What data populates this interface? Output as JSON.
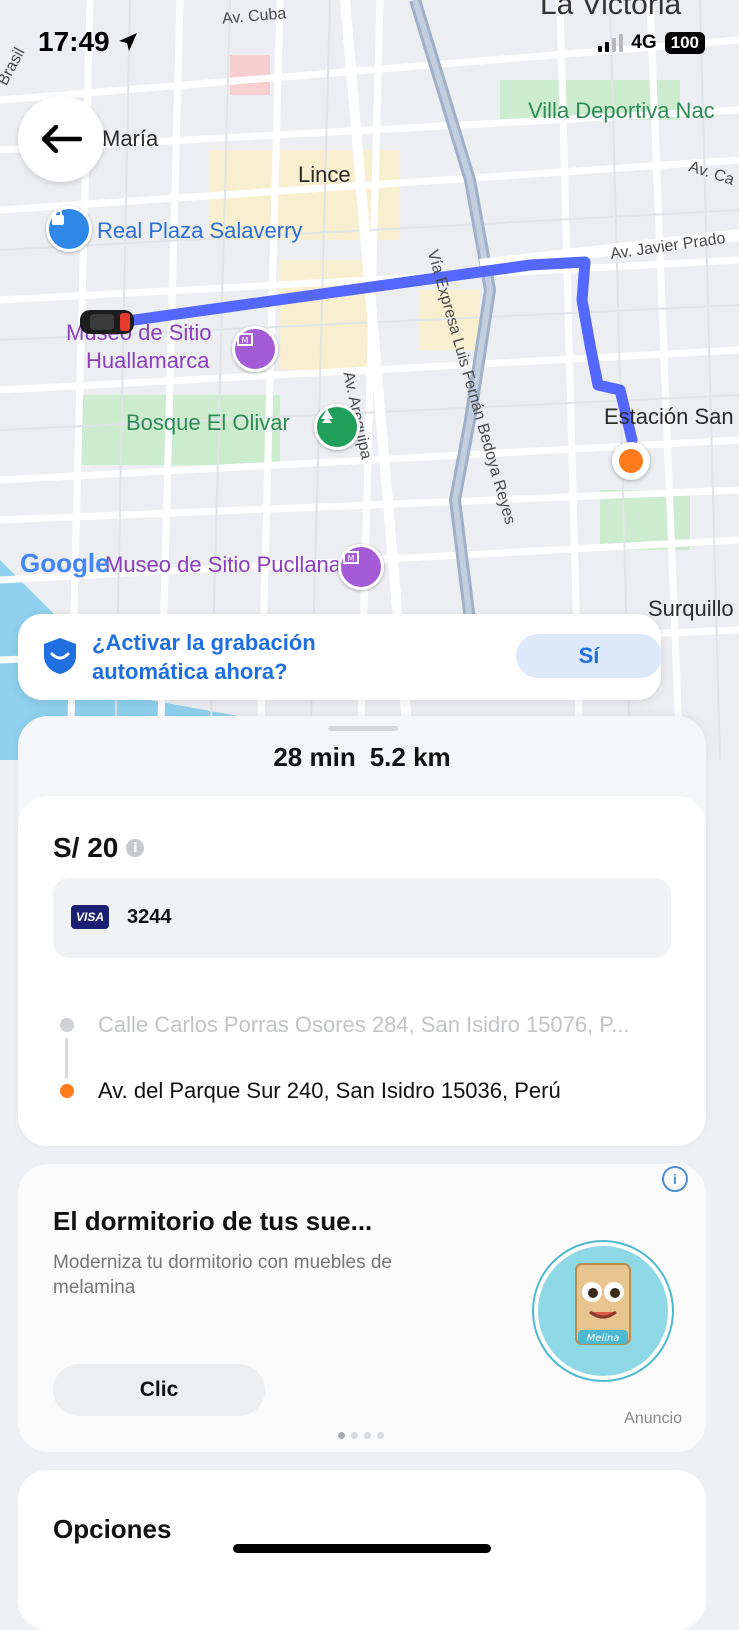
{
  "status_bar": {
    "time": "17:49",
    "network": "4G",
    "battery": "100"
  },
  "map": {
    "labels": {
      "top_right": "La Victoria",
      "av_cuba": "Av. Cuba",
      "brasil": "Brasil",
      "maria": "María",
      "lince": "Lince",
      "villa_deportiva": "Villa Deportiva Nac",
      "av_ca": "Av. Ca",
      "real_plaza": "Real Plaza Salaverry",
      "via_expresa": "Vía Expresa Luis Fernán Bedoya Reyes",
      "av_javier_prado": "Av. Javier Prado",
      "museo_hualla_1": "Museo de Sitio",
      "museo_hualla_2": "Huallamarca",
      "av_arequipa": "Av. Arequipa",
      "estacion": "Estación San",
      "bosque": "Bosque El Olivar",
      "museo_pucllana": "Museo de Sitio Pucllana",
      "surquillo": "Surquillo",
      "google": "Google"
    },
    "colors": {
      "route": "#5468ff",
      "destination": "#ff7a1a"
    }
  },
  "recording_banner": {
    "text": "¿Activar la grabación automática ahora?",
    "button": "Sí"
  },
  "trip": {
    "duration": "28 min",
    "distance": "5.2 km",
    "fare": "S/ 20",
    "payment": {
      "brand": "VISA",
      "last4": "3244"
    },
    "origin": "Calle Carlos Porras Osores 284, San Isidro 15076, P...",
    "destination": "Av. del Parque Sur 240, San Isidro 15036, Perú"
  },
  "ad": {
    "title": "El dormitorio de tus sue...",
    "description": "Moderniza tu dormitorio con muebles de melamina",
    "cta": "Clic",
    "sponsored": "Anuncio",
    "logo_text": "Melina"
  },
  "options": {
    "title": "Opciones"
  }
}
